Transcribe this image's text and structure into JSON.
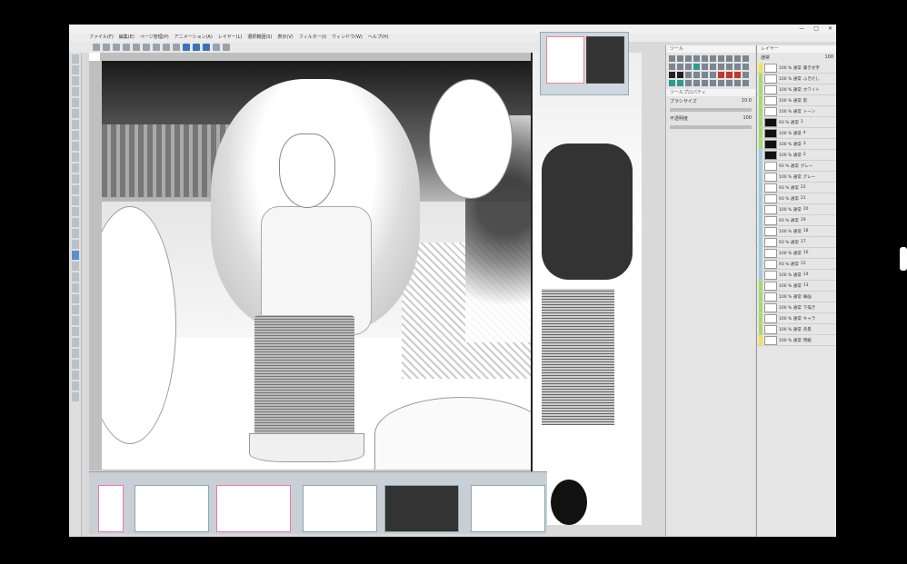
{
  "window": {
    "title": "",
    "controls": [
      "—",
      "□",
      "✕"
    ]
  },
  "menubar": {
    "items": [
      "ファイル(F)",
      "編集(E)",
      "ページ管理(P)",
      "アニメーション(A)",
      "レイヤー(L)",
      "選択範囲(S)",
      "表示(V)",
      "フィルター(I)",
      "ウィンドウ(W)",
      "ヘルプ(H)"
    ]
  },
  "canvas": {
    "tab_label": "",
    "page_title": ""
  },
  "tool_palette": {
    "title": "ツール",
    "sub_title": "サブツール",
    "properties_title": "ツールプロパティ",
    "brush_size_label": "ブラシサイズ",
    "brush_size_value": "10.0",
    "opacity_label": "不透明度",
    "opacity_value": "100"
  },
  "layer_palette": {
    "title": "レイヤー",
    "blend_mode": "通常",
    "opacity_value": "100",
    "layers": [
      {
        "name": "100 % 通常",
        "sub": "書き文字",
        "color": "#f2e34a"
      },
      {
        "name": "100 % 通常",
        "sub": "ふきだし",
        "color": "#a8d96b"
      },
      {
        "name": "100 % 通常",
        "sub": "ホワイト",
        "color": "#a8d96b"
      },
      {
        "name": "100 % 通常",
        "sub": "影",
        "color": "#a8d96b"
      },
      {
        "name": "100 % 通常",
        "sub": "トーン",
        "color": "#a8d96b"
      },
      {
        "name": "93 % 通常",
        "sub": "1",
        "color": "#a8d96b"
      },
      {
        "name": "100 % 通常",
        "sub": "4",
        "color": "#a8d96b"
      },
      {
        "name": "100 % 通常",
        "sub": "3",
        "color": "#a8d96b"
      },
      {
        "name": "100 % 通常",
        "sub": "2",
        "color": "#9ecde0"
      },
      {
        "name": "93 % 通常",
        "sub": "グレー",
        "color": "#9ecde0"
      },
      {
        "name": "100 % 通常",
        "sub": "グレー",
        "color": "#9ecde0"
      },
      {
        "name": "93 % 通常",
        "sub": "22",
        "color": "#9ecde0"
      },
      {
        "name": "93 % 通常",
        "sub": "21",
        "color": "#9ecde0"
      },
      {
        "name": "100 % 通常",
        "sub": "20",
        "color": "#9ecde0"
      },
      {
        "name": "93 % 通常",
        "sub": "19",
        "color": "#9ecde0"
      },
      {
        "name": "100 % 通常",
        "sub": "18",
        "color": "#9ecde0"
      },
      {
        "name": "93 % 通常",
        "sub": "17",
        "color": "#9ecde0"
      },
      {
        "name": "100 % 通常",
        "sub": "16",
        "color": "#9ecde0"
      },
      {
        "name": "93 % 通常",
        "sub": "15",
        "color": "#9ecde0"
      },
      {
        "name": "100 % 通常",
        "sub": "14",
        "color": "#9ecde0"
      },
      {
        "name": "100 % 通常",
        "sub": "13",
        "color": "#a8d96b"
      },
      {
        "name": "100 % 通常",
        "sub": "線画",
        "color": "#a8d96b"
      },
      {
        "name": "100 % 通常",
        "sub": "下描き",
        "color": "#a8d96b"
      },
      {
        "name": "100 % 通常",
        "sub": "キャラ",
        "color": "#a8d96b"
      },
      {
        "name": "100 % 通常",
        "sub": "背景",
        "color": "#a8d96b"
      },
      {
        "name": "100 % 通常",
        "sub": "用紙",
        "color": "#f2e34a"
      }
    ]
  },
  "colors": {
    "accent": "#3b73b9",
    "panel_bg": "#e4e4e4",
    "filmstrip_bg": "#c9cfd6"
  }
}
